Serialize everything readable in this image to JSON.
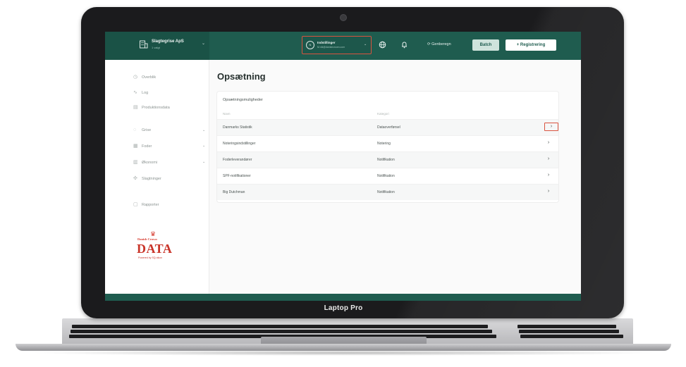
{
  "device": {
    "brand": "Laptop Pro"
  },
  "header": {
    "org_name": "Slagtegrise ApS",
    "org_sub": "1 valgt",
    "account_name": "Indstillinger",
    "account_sub": "M.nik@danishcrown.com",
    "avatar_initial": "N",
    "recalc_label": "Genberegn",
    "batch_label": "Batch",
    "register_label": "+ Registrering"
  },
  "sidebar": {
    "items": [
      {
        "label": "Overblik",
        "icon": "dashboard-icon"
      },
      {
        "label": "Log",
        "icon": "pulse-icon"
      },
      {
        "label": "Produktionsdata",
        "icon": "chart-icon"
      },
      {
        "label": "Grise",
        "icon": "pig-icon",
        "expandable": true
      },
      {
        "label": "Foder",
        "icon": "feed-icon",
        "expandable": true
      },
      {
        "label": "Økonomi",
        "icon": "finance-icon",
        "expandable": true
      },
      {
        "label": "Slagtninger",
        "icon": "slaughter-icon"
      },
      {
        "label": "Rapporter",
        "icon": "report-icon"
      }
    ],
    "logo": {
      "name": "Danish Crown",
      "word": "DATA",
      "powered": "Powered by SQ-nikon"
    }
  },
  "main": {
    "title": "Opsætning",
    "card_title": "Opsætningsmuligheder",
    "columns": [
      "Navn",
      "Kategori"
    ],
    "rows": [
      {
        "name": "Danmarks Statistik",
        "category": "Dataoverførsel"
      },
      {
        "name": "Noteringsindstillinger",
        "category": "Notering"
      },
      {
        "name": "Foderleverandører",
        "category": "Notifikation"
      },
      {
        "name": "SPF-notifikationer",
        "category": "Notifikation"
      },
      {
        "name": "Big Dutchman",
        "category": "Notifikation"
      }
    ]
  },
  "colors": {
    "header": "#1f5c4f",
    "highlight": "#d9533f",
    "brand_red": "#c9352a"
  }
}
